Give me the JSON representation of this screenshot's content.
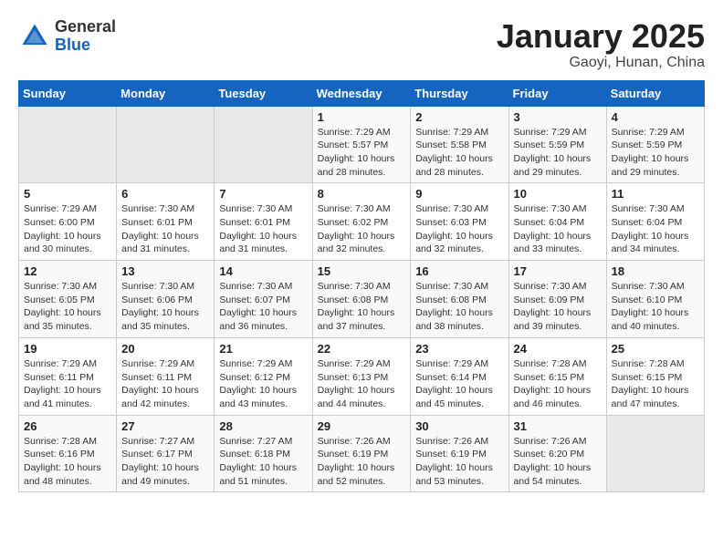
{
  "header": {
    "logo_general": "General",
    "logo_blue": "Blue",
    "title": "January 2025",
    "subtitle": "Gaoyi, Hunan, China"
  },
  "weekdays": [
    "Sunday",
    "Monday",
    "Tuesday",
    "Wednesday",
    "Thursday",
    "Friday",
    "Saturday"
  ],
  "weeks": [
    [
      {
        "day": "",
        "info": ""
      },
      {
        "day": "",
        "info": ""
      },
      {
        "day": "",
        "info": ""
      },
      {
        "day": "1",
        "info": "Sunrise: 7:29 AM\nSunset: 5:57 PM\nDaylight: 10 hours and 28 minutes."
      },
      {
        "day": "2",
        "info": "Sunrise: 7:29 AM\nSunset: 5:58 PM\nDaylight: 10 hours and 28 minutes."
      },
      {
        "day": "3",
        "info": "Sunrise: 7:29 AM\nSunset: 5:59 PM\nDaylight: 10 hours and 29 minutes."
      },
      {
        "day": "4",
        "info": "Sunrise: 7:29 AM\nSunset: 5:59 PM\nDaylight: 10 hours and 29 minutes."
      }
    ],
    [
      {
        "day": "5",
        "info": "Sunrise: 7:29 AM\nSunset: 6:00 PM\nDaylight: 10 hours and 30 minutes."
      },
      {
        "day": "6",
        "info": "Sunrise: 7:30 AM\nSunset: 6:01 PM\nDaylight: 10 hours and 31 minutes."
      },
      {
        "day": "7",
        "info": "Sunrise: 7:30 AM\nSunset: 6:01 PM\nDaylight: 10 hours and 31 minutes."
      },
      {
        "day": "8",
        "info": "Sunrise: 7:30 AM\nSunset: 6:02 PM\nDaylight: 10 hours and 32 minutes."
      },
      {
        "day": "9",
        "info": "Sunrise: 7:30 AM\nSunset: 6:03 PM\nDaylight: 10 hours and 32 minutes."
      },
      {
        "day": "10",
        "info": "Sunrise: 7:30 AM\nSunset: 6:04 PM\nDaylight: 10 hours and 33 minutes."
      },
      {
        "day": "11",
        "info": "Sunrise: 7:30 AM\nSunset: 6:04 PM\nDaylight: 10 hours and 34 minutes."
      }
    ],
    [
      {
        "day": "12",
        "info": "Sunrise: 7:30 AM\nSunset: 6:05 PM\nDaylight: 10 hours and 35 minutes."
      },
      {
        "day": "13",
        "info": "Sunrise: 7:30 AM\nSunset: 6:06 PM\nDaylight: 10 hours and 35 minutes."
      },
      {
        "day": "14",
        "info": "Sunrise: 7:30 AM\nSunset: 6:07 PM\nDaylight: 10 hours and 36 minutes."
      },
      {
        "day": "15",
        "info": "Sunrise: 7:30 AM\nSunset: 6:08 PM\nDaylight: 10 hours and 37 minutes."
      },
      {
        "day": "16",
        "info": "Sunrise: 7:30 AM\nSunset: 6:08 PM\nDaylight: 10 hours and 38 minutes."
      },
      {
        "day": "17",
        "info": "Sunrise: 7:30 AM\nSunset: 6:09 PM\nDaylight: 10 hours and 39 minutes."
      },
      {
        "day": "18",
        "info": "Sunrise: 7:30 AM\nSunset: 6:10 PM\nDaylight: 10 hours and 40 minutes."
      }
    ],
    [
      {
        "day": "19",
        "info": "Sunrise: 7:29 AM\nSunset: 6:11 PM\nDaylight: 10 hours and 41 minutes."
      },
      {
        "day": "20",
        "info": "Sunrise: 7:29 AM\nSunset: 6:11 PM\nDaylight: 10 hours and 42 minutes."
      },
      {
        "day": "21",
        "info": "Sunrise: 7:29 AM\nSunset: 6:12 PM\nDaylight: 10 hours and 43 minutes."
      },
      {
        "day": "22",
        "info": "Sunrise: 7:29 AM\nSunset: 6:13 PM\nDaylight: 10 hours and 44 minutes."
      },
      {
        "day": "23",
        "info": "Sunrise: 7:29 AM\nSunset: 6:14 PM\nDaylight: 10 hours and 45 minutes."
      },
      {
        "day": "24",
        "info": "Sunrise: 7:28 AM\nSunset: 6:15 PM\nDaylight: 10 hours and 46 minutes."
      },
      {
        "day": "25",
        "info": "Sunrise: 7:28 AM\nSunset: 6:15 PM\nDaylight: 10 hours and 47 minutes."
      }
    ],
    [
      {
        "day": "26",
        "info": "Sunrise: 7:28 AM\nSunset: 6:16 PM\nDaylight: 10 hours and 48 minutes."
      },
      {
        "day": "27",
        "info": "Sunrise: 7:27 AM\nSunset: 6:17 PM\nDaylight: 10 hours and 49 minutes."
      },
      {
        "day": "28",
        "info": "Sunrise: 7:27 AM\nSunset: 6:18 PM\nDaylight: 10 hours and 51 minutes."
      },
      {
        "day": "29",
        "info": "Sunrise: 7:26 AM\nSunset: 6:19 PM\nDaylight: 10 hours and 52 minutes."
      },
      {
        "day": "30",
        "info": "Sunrise: 7:26 AM\nSunset: 6:19 PM\nDaylight: 10 hours and 53 minutes."
      },
      {
        "day": "31",
        "info": "Sunrise: 7:26 AM\nSunset: 6:20 PM\nDaylight: 10 hours and 54 minutes."
      },
      {
        "day": "",
        "info": ""
      }
    ]
  ]
}
